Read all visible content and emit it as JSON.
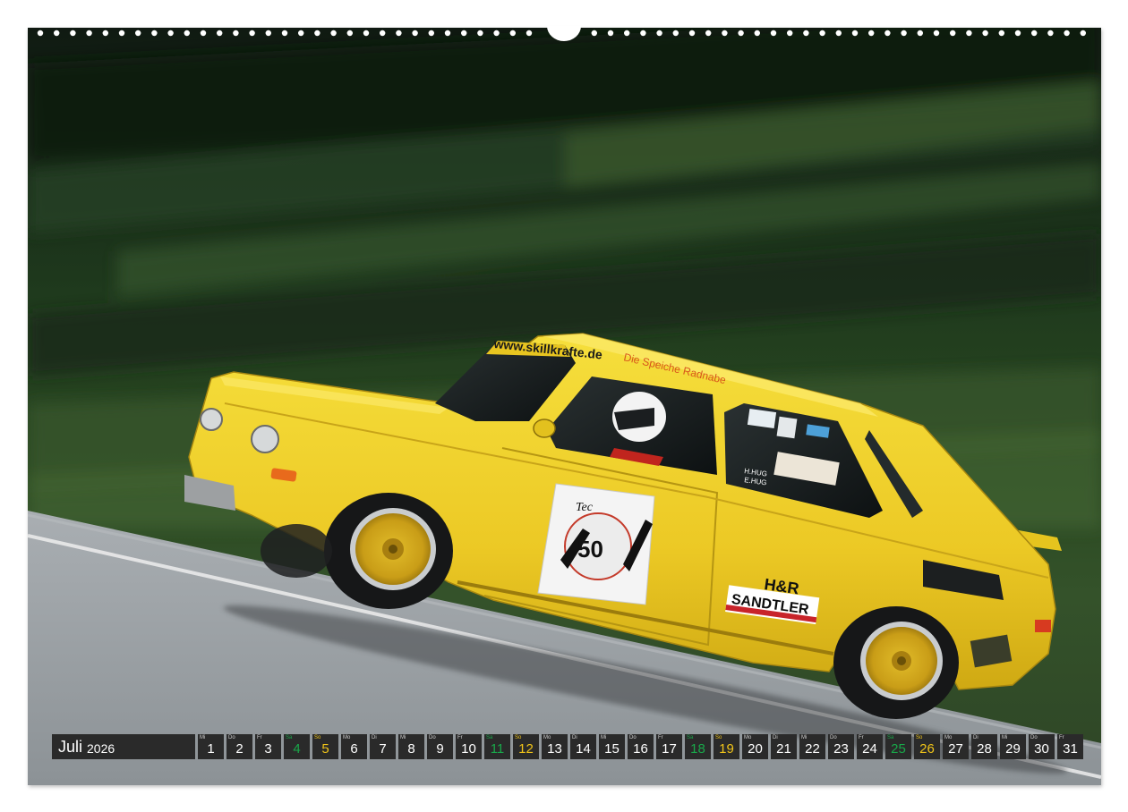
{
  "calendar": {
    "month": "Juli",
    "year": "2026",
    "colors": {
      "background": "#2a2a2a",
      "text": "#ffffff",
      "saturday": "#f0c419",
      "sunday": "#19a84a"
    },
    "days": [
      {
        "wd": "Mi",
        "num": "1",
        "type": "weekday"
      },
      {
        "wd": "Do",
        "num": "2",
        "type": "weekday"
      },
      {
        "wd": "Fr",
        "num": "3",
        "type": "weekday"
      },
      {
        "wd": "Sa",
        "num": "4",
        "type": "sun"
      },
      {
        "wd": "So",
        "num": "5",
        "type": "sat"
      },
      {
        "wd": "Mo",
        "num": "6",
        "type": "weekday"
      },
      {
        "wd": "Di",
        "num": "7",
        "type": "weekday"
      },
      {
        "wd": "Mi",
        "num": "8",
        "type": "weekday"
      },
      {
        "wd": "Do",
        "num": "9",
        "type": "weekday"
      },
      {
        "wd": "Fr",
        "num": "10",
        "type": "weekday"
      },
      {
        "wd": "Sa",
        "num": "11",
        "type": "sun"
      },
      {
        "wd": "So",
        "num": "12",
        "type": "sat"
      },
      {
        "wd": "Mo",
        "num": "13",
        "type": "weekday"
      },
      {
        "wd": "Di",
        "num": "14",
        "type": "weekday"
      },
      {
        "wd": "Mi",
        "num": "15",
        "type": "weekday"
      },
      {
        "wd": "Do",
        "num": "16",
        "type": "weekday"
      },
      {
        "wd": "Fr",
        "num": "17",
        "type": "weekday"
      },
      {
        "wd": "Sa",
        "num": "18",
        "type": "sun"
      },
      {
        "wd": "So",
        "num": "19",
        "type": "sat"
      },
      {
        "wd": "Mo",
        "num": "20",
        "type": "weekday"
      },
      {
        "wd": "Di",
        "num": "21",
        "type": "weekday"
      },
      {
        "wd": "Mi",
        "num": "22",
        "type": "weekday"
      },
      {
        "wd": "Do",
        "num": "23",
        "type": "weekday"
      },
      {
        "wd": "Fr",
        "num": "24",
        "type": "weekday"
      },
      {
        "wd": "Sa",
        "num": "25",
        "type": "sun"
      },
      {
        "wd": "So",
        "num": "26",
        "type": "sat"
      },
      {
        "wd": "Mo",
        "num": "27",
        "type": "weekday"
      },
      {
        "wd": "Di",
        "num": "28",
        "type": "weekday"
      },
      {
        "wd": "Mi",
        "num": "29",
        "type": "weekday"
      },
      {
        "wd": "Do",
        "num": "30",
        "type": "weekday"
      },
      {
        "wd": "Fr",
        "num": "31",
        "type": "weekday"
      }
    ]
  },
  "photo": {
    "windshield_banner": "www.skillkrafte.de",
    "roof_text": "Die Speiche Radnabe",
    "start_number": "50",
    "door_logo_text": "Tec",
    "sticker_hr": "H&R",
    "sticker_sandtler": "SANDTLER",
    "window_name_1": "H.HUG",
    "window_name_2": "E.HUG",
    "colors": {
      "car": "#efd12a",
      "wheel": "#d9b21f",
      "road": "#9da3a7",
      "forest": "#1f3a1d"
    }
  }
}
